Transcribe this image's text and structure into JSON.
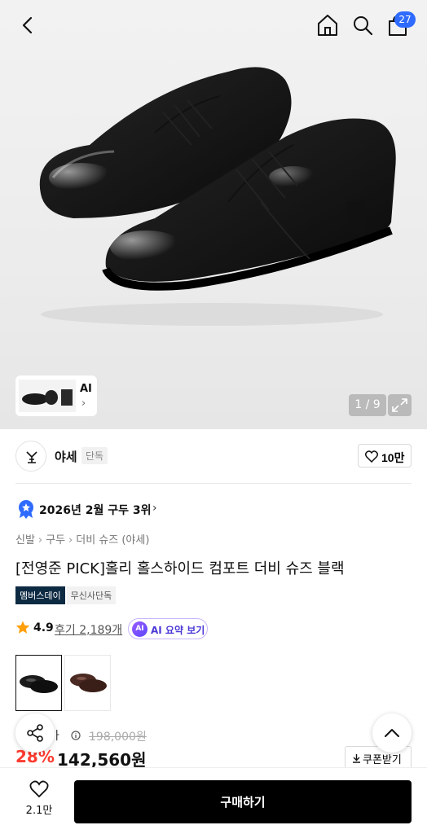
{
  "header": {
    "cart_count": "27"
  },
  "gallery": {
    "ai_label": "AI",
    "pager": "1 / 9"
  },
  "brand": {
    "name": "야세",
    "tag": "단독",
    "likes": "10만"
  },
  "rank": {
    "text": "2026년 2월 구두 3위"
  },
  "breadcrumbs": [
    "신발",
    "구두",
    "더비 슈즈 (야세)"
  ],
  "product": {
    "title": "[전영준 PICK]홀리 홀스하이드 컴포트 더비 슈즈 블랙",
    "tags": [
      "멤버스데이",
      "무신사단독"
    ],
    "rating": "4.9",
    "reviews": "후기 2,189개",
    "ai_summary": "AI 요약 보기",
    "ai_badge": "AI"
  },
  "colors": [
    "black",
    "brown"
  ],
  "price": {
    "label": "정상가",
    "label_visible": "상가",
    "original": "198,000원",
    "discount": "28%",
    "final": "142,560원",
    "coupon": "쿠폰받기"
  },
  "bottom": {
    "wish_count": "2.1만",
    "buy": "구매하기"
  },
  "accent": {
    "blue": "#2f6bff",
    "red": "#ff3b30",
    "navy": "#0d2a43",
    "star": "#ff9f0a"
  }
}
